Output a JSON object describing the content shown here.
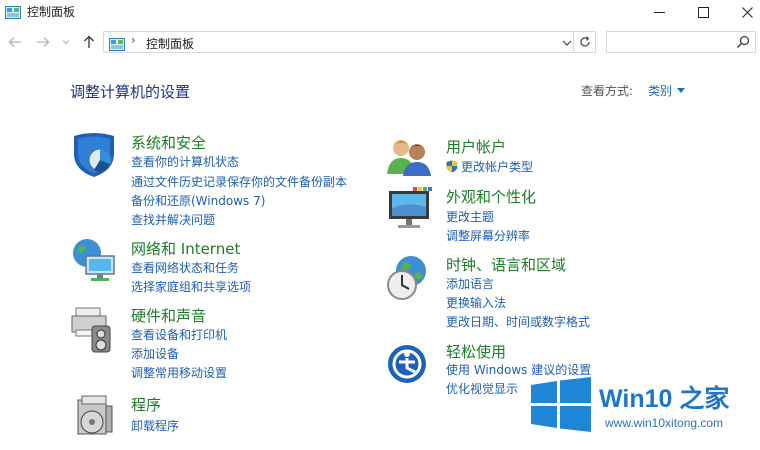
{
  "window": {
    "title": "控制面板"
  },
  "address_bar": {
    "separator": "›",
    "path": "控制面板"
  },
  "search": {
    "placeholder": "",
    "value": ""
  },
  "main": {
    "heading": "调整计算机的设置",
    "view_by_label": "查看方式:",
    "view_by_value": "类别"
  },
  "categories": [
    {
      "title": "系统和安全",
      "icon": "system-security-icon",
      "links": [
        "查看你的计算机状态",
        "通过文件历史记录保存你的文件备份副本",
        "备份和还原(Windows 7)",
        "查找并解决问题"
      ]
    },
    {
      "title": "网络和 Internet",
      "icon": "network-internet-icon",
      "links": [
        "查看网络状态和任务",
        "选择家庭组和共享选项"
      ]
    },
    {
      "title": "硬件和声音",
      "icon": "hardware-sound-icon",
      "links": [
        "查看设备和打印机",
        "添加设备",
        "调整常用移动设置"
      ]
    },
    {
      "title": "程序",
      "icon": "programs-icon",
      "links": [
        "卸载程序"
      ]
    },
    {
      "title": "用户帐户",
      "icon": "user-accounts-icon",
      "links": [
        "更改帐户类型"
      ]
    },
    {
      "title": "外观和个性化",
      "icon": "appearance-icon",
      "links": [
        "更改主题",
        "调整屏幕分辨率"
      ]
    },
    {
      "title": "时钟、语言和区域",
      "icon": "clock-language-region-icon",
      "links": [
        "添加语言",
        "更换输入法",
        "更改日期、时间或数字格式"
      ]
    },
    {
      "title": "轻松使用",
      "icon": "ease-of-access-icon",
      "links": [
        "使用 Windows 建议的设置",
        "优化视觉显示"
      ]
    }
  ],
  "watermark": {
    "brand": "Win10 之家",
    "url": "www.win10xitong.com"
  },
  "colors": {
    "category_title": "#1d7d28",
    "link": "#1f5fb6",
    "heading": "#1e3287",
    "watermark_blue": "#1f76c8"
  }
}
